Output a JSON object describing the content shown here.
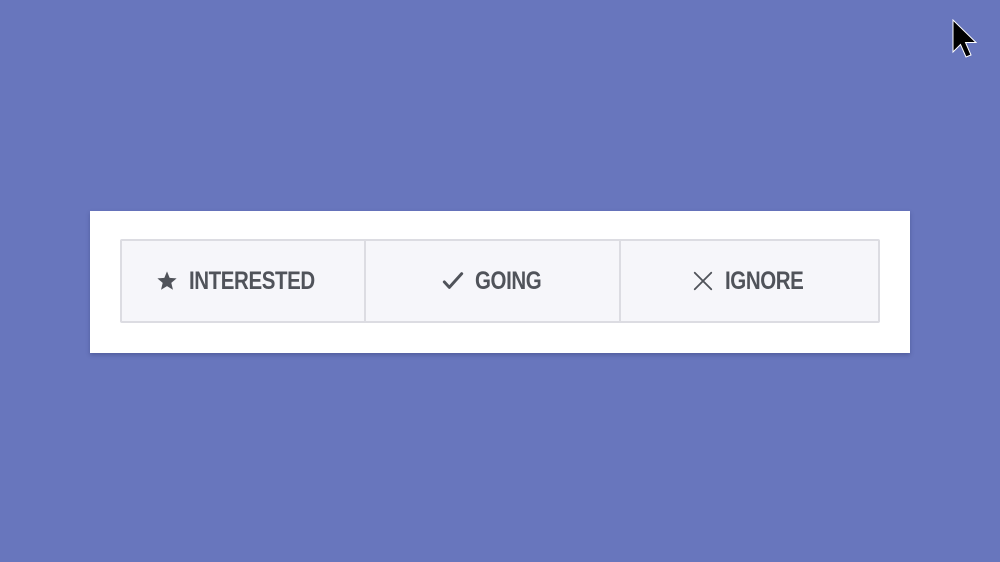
{
  "background_color": "#6876bd",
  "cursor": {
    "icon": "arrow-pointer-icon"
  },
  "rsvp": {
    "buttons": [
      {
        "label": "INTERESTED",
        "icon": "star-icon"
      },
      {
        "label": "GOING",
        "icon": "checkmark-icon"
      },
      {
        "label": "IGNORE",
        "icon": "close-icon"
      }
    ],
    "text_color": "#50535a",
    "button_background": "#f6f6fa",
    "border_color": "#dcdce2"
  }
}
